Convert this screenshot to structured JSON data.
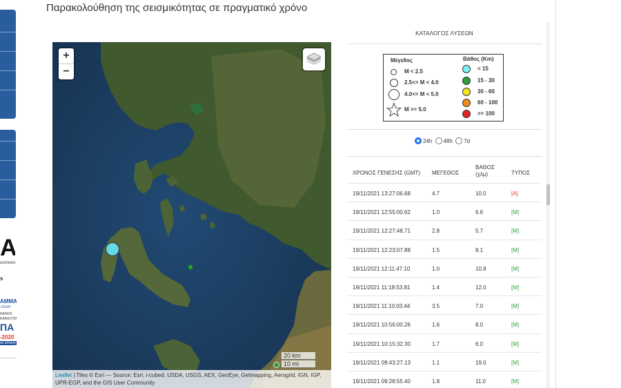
{
  "page": {
    "title": "Παρακολούθηση της σεισμικότητας σε πραγματικό χρόνο"
  },
  "left_logos": {
    "archives_text": "urchives",
    "letter": "A",
    "s_text": "s",
    "amma": "AMMA",
    "year1": "-2020",
    "small1": "ΝΑΝΣΗ",
    "small2": "ΚΑΙΝΟΤΟΜΙΑ",
    "epa": "ΠΑ",
    "year2": "-2020",
    "small3": "σε αλλαγή"
  },
  "map": {
    "zoom_in": "+",
    "zoom_out": "−",
    "scale_km": "20 km",
    "scale_mi": "10 mi",
    "attrib_leaflet": "Leaflet",
    "attrib_text": " | Tiles © Esri — Source: Esri, i-cubed, USDA, USGS, AEX, GeoEye, Getmapping, Aerogrid, IGN, IGP, UPR-EGP, and the GIS User Community",
    "events": [
      {
        "depth_class": "<15",
        "color": "#66d8e8",
        "magnitude_class": "4.0<=M<5.0"
      },
      {
        "depth_class": "15-30",
        "color": "#2e9e3e",
        "magnitude_class": "M<2.5"
      },
      {
        "depth_class": "15-30",
        "color": "#2e9e3e",
        "magnitude_class": "M<2.5"
      }
    ]
  },
  "panel": {
    "title": "ΚΑΤΑΛΟΓΟΣ ΛΥΣΕΩΝ",
    "legend": {
      "magnitude_header": "Μέγεθος",
      "depth_header": "Βάθος (Km)",
      "magnitudes": [
        "M < 2.5",
        "2.5<= M < 4.0",
        "4.0<= M < 5.0",
        "M >= 5.0"
      ],
      "depths": [
        {
          "label": "< 15",
          "color": "#7ff0f0"
        },
        {
          "label": "15 - 30",
          "color": "#2e9e3e"
        },
        {
          "label": "30 - 60",
          "color": "#f2e81c"
        },
        {
          "label": "60 - 100",
          "color": "#f28c1c"
        },
        {
          "label": ">= 100",
          "color": "#e32424"
        }
      ]
    },
    "periods": {
      "selected": "24h",
      "options": [
        "24h",
        "48h",
        "7d"
      ]
    },
    "table": {
      "headers": {
        "time": "ΧΡΟΝΟΣ ΓΕΝΕΣΗΣ (GMT)",
        "magnitude": "ΜΕΓΕΘΟΣ",
        "depth1": "ΒΑΘΟΣ",
        "depth2": "(χλμ)",
        "type": "ΤΥΠΟΣ"
      },
      "rows": [
        {
          "time": "19/11/2021 13:27:06.68",
          "mag": "4.7",
          "depth": "10.0",
          "type": "[A]"
        },
        {
          "time": "19/11/2021 12:55:00.62",
          "mag": "1.0",
          "depth": "6.6",
          "type": "[M]"
        },
        {
          "time": "19/11/2021 12:27:48.71",
          "mag": "2.8",
          "depth": "5.7",
          "type": "[M]"
        },
        {
          "time": "19/11/2021 12:23:07.88",
          "mag": "1.5",
          "depth": "8.1",
          "type": "[M]"
        },
        {
          "time": "19/11/2021 12:11:47.10",
          "mag": "1.0",
          "depth": "10.8",
          "type": "[M]"
        },
        {
          "time": "19/11/2021 11:18:53.81",
          "mag": "1.4",
          "depth": "12.0",
          "type": "[M]"
        },
        {
          "time": "19/11/2021 11:10:03.44",
          "mag": "3.5",
          "depth": "7.0",
          "type": "[M]"
        },
        {
          "time": "19/11/2021 10:56:00.26",
          "mag": "1.6",
          "depth": "8.0",
          "type": "[M]"
        },
        {
          "time": "19/11/2021 10:15:32.30",
          "mag": "1.7",
          "depth": "6.0",
          "type": "[M]"
        },
        {
          "time": "19/11/2021 09:43:27.13",
          "mag": "1.1",
          "depth": "19.0",
          "type": "[M]"
        },
        {
          "time": "19/11/2021 09:28:55.40",
          "mag": "1.8",
          "depth": "11.0",
          "type": "[M]"
        }
      ],
      "type_colors": {
        "[A]": "#d9362b",
        "[M]": "#2e9e3e"
      }
    }
  }
}
